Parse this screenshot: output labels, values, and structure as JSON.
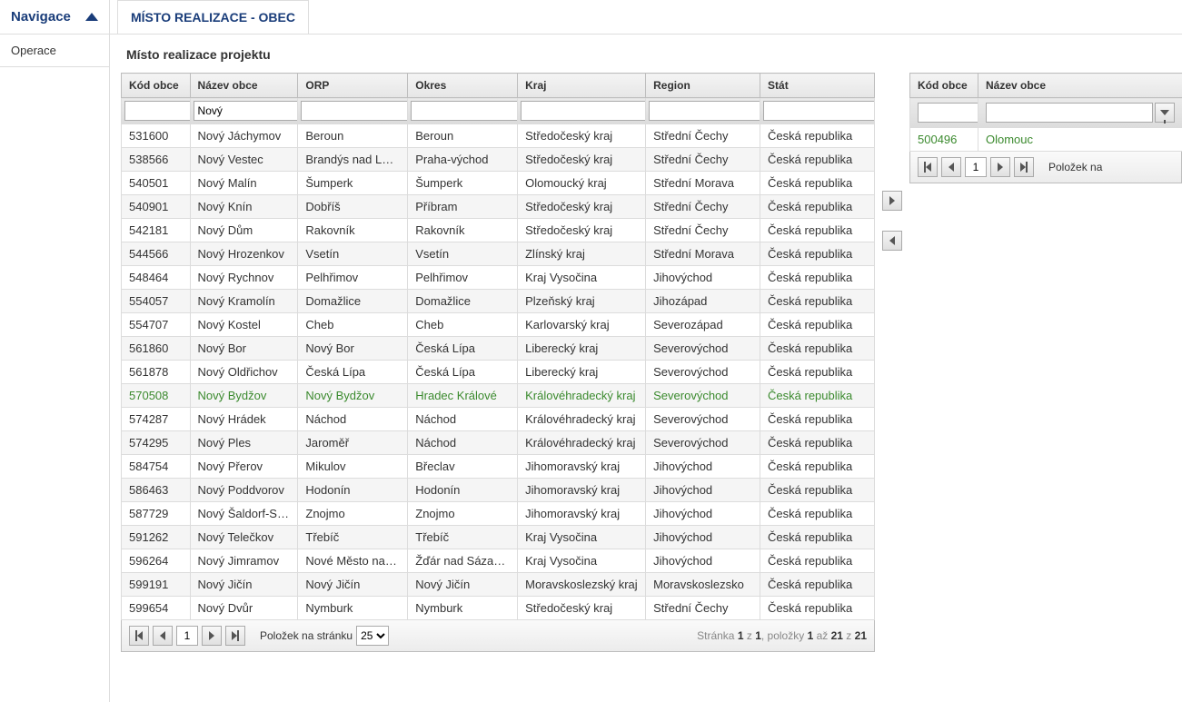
{
  "sidebar": {
    "nav_label": "Navigace",
    "item1": "Operace"
  },
  "tab": {
    "title": "MÍSTO REALIZACE - OBEC"
  },
  "panel": {
    "title": "Místo realizace projektu"
  },
  "grid1": {
    "headers": {
      "kod": "Kód obce",
      "nazev": "Název obce",
      "orp": "ORP",
      "okres": "Okres",
      "kraj": "Kraj",
      "region": "Region",
      "stat": "Stát"
    },
    "filter": {
      "nazev": "Nový"
    },
    "rows": [
      {
        "kod": "531600",
        "nazev": "Nový Jáchymov",
        "orp": "Beroun",
        "okres": "Beroun",
        "kraj": "Středočeský kraj",
        "region": "Střední Čechy",
        "stat": "Česká republika"
      },
      {
        "kod": "538566",
        "nazev": "Nový Vestec",
        "orp": "Brandýs nad Lab...",
        "okres": "Praha-východ",
        "kraj": "Středočeský kraj",
        "region": "Střední Čechy",
        "stat": "Česká republika"
      },
      {
        "kod": "540501",
        "nazev": "Nový Malín",
        "orp": "Šumperk",
        "okres": "Šumperk",
        "kraj": "Olomoucký kraj",
        "region": "Střední Morava",
        "stat": "Česká republika"
      },
      {
        "kod": "540901",
        "nazev": "Nový Knín",
        "orp": "Dobříš",
        "okres": "Příbram",
        "kraj": "Středočeský kraj",
        "region": "Střední Čechy",
        "stat": "Česká republika"
      },
      {
        "kod": "542181",
        "nazev": "Nový Dům",
        "orp": "Rakovník",
        "okres": "Rakovník",
        "kraj": "Středočeský kraj",
        "region": "Střední Čechy",
        "stat": "Česká republika"
      },
      {
        "kod": "544566",
        "nazev": "Nový Hrozenkov",
        "orp": "Vsetín",
        "okres": "Vsetín",
        "kraj": "Zlínský kraj",
        "region": "Střední Morava",
        "stat": "Česká republika"
      },
      {
        "kod": "548464",
        "nazev": "Nový Rychnov",
        "orp": "Pelhřimov",
        "okres": "Pelhřimov",
        "kraj": "Kraj Vysočina",
        "region": "Jihovýchod",
        "stat": "Česká republika"
      },
      {
        "kod": "554057",
        "nazev": "Nový Kramolín",
        "orp": "Domažlice",
        "okres": "Domažlice",
        "kraj": "Plzeňský kraj",
        "region": "Jihozápad",
        "stat": "Česká republika"
      },
      {
        "kod": "554707",
        "nazev": "Nový Kostel",
        "orp": "Cheb",
        "okres": "Cheb",
        "kraj": "Karlovarský kraj",
        "region": "Severozápad",
        "stat": "Česká republika"
      },
      {
        "kod": "561860",
        "nazev": "Nový Bor",
        "orp": "Nový Bor",
        "okres": "Česká Lípa",
        "kraj": "Liberecký kraj",
        "region": "Severovýchod",
        "stat": "Česká republika"
      },
      {
        "kod": "561878",
        "nazev": "Nový Oldřichov",
        "orp": "Česká Lípa",
        "okres": "Česká Lípa",
        "kraj": "Liberecký kraj",
        "region": "Severovýchod",
        "stat": "Česká republika"
      },
      {
        "kod": "570508",
        "nazev": "Nový Bydžov",
        "orp": "Nový Bydžov",
        "okres": "Hradec Králové",
        "kraj": "Královéhradecký kraj",
        "region": "Severovýchod",
        "stat": "Česká republika",
        "selected": true
      },
      {
        "kod": "574287",
        "nazev": "Nový Hrádek",
        "orp": "Náchod",
        "okres": "Náchod",
        "kraj": "Královéhradecký kraj",
        "region": "Severovýchod",
        "stat": "Česká republika"
      },
      {
        "kod": "574295",
        "nazev": "Nový Ples",
        "orp": "Jaroměř",
        "okres": "Náchod",
        "kraj": "Královéhradecký kraj",
        "region": "Severovýchod",
        "stat": "Česká republika"
      },
      {
        "kod": "584754",
        "nazev": "Nový Přerov",
        "orp": "Mikulov",
        "okres": "Břeclav",
        "kraj": "Jihomoravský kraj",
        "region": "Jihovýchod",
        "stat": "Česká republika"
      },
      {
        "kod": "586463",
        "nazev": "Nový Poddvorov",
        "orp": "Hodonín",
        "okres": "Hodonín",
        "kraj": "Jihomoravský kraj",
        "region": "Jihovýchod",
        "stat": "Česká republika"
      },
      {
        "kod": "587729",
        "nazev": "Nový Šaldorf-Sed...",
        "orp": "Znojmo",
        "okres": "Znojmo",
        "kraj": "Jihomoravský kraj",
        "region": "Jihovýchod",
        "stat": "Česká republika"
      },
      {
        "kod": "591262",
        "nazev": "Nový Telečkov",
        "orp": "Třebíč",
        "okres": "Třebíč",
        "kraj": "Kraj Vysočina",
        "region": "Jihovýchod",
        "stat": "Česká republika"
      },
      {
        "kod": "596264",
        "nazev": "Nový Jimramov",
        "orp": "Nové Město na M...",
        "okres": "Žďár nad Sázavou",
        "kraj": "Kraj Vysočina",
        "region": "Jihovýchod",
        "stat": "Česká republika"
      },
      {
        "kod": "599191",
        "nazev": "Nový Jičín",
        "orp": "Nový Jičín",
        "okres": "Nový Jičín",
        "kraj": "Moravskoslezský kraj",
        "region": "Moravskoslezsko",
        "stat": "Česká republika"
      },
      {
        "kod": "599654",
        "nazev": "Nový Dvůr",
        "orp": "Nymburk",
        "okres": "Nymburk",
        "kraj": "Středočeský kraj",
        "region": "Střední Čechy",
        "stat": "Česká republika"
      }
    ]
  },
  "pager1": {
    "page": "1",
    "items_label": "Položek na stránku",
    "page_size": "25",
    "info_prefix": "Stránka ",
    "p1": "1",
    "of": " z ",
    "p2": "1",
    "items_prefix": ", položky ",
    "i1": "1",
    "to": " až ",
    "i2": "21",
    "of2": " z ",
    "i3": "21"
  },
  "grid2": {
    "headers": {
      "kod": "Kód obce",
      "nazev": "Název obce"
    },
    "rows": [
      {
        "kod": "500496",
        "nazev": "Olomouc"
      }
    ]
  },
  "pager2": {
    "page": "1",
    "label": "Položek na"
  }
}
